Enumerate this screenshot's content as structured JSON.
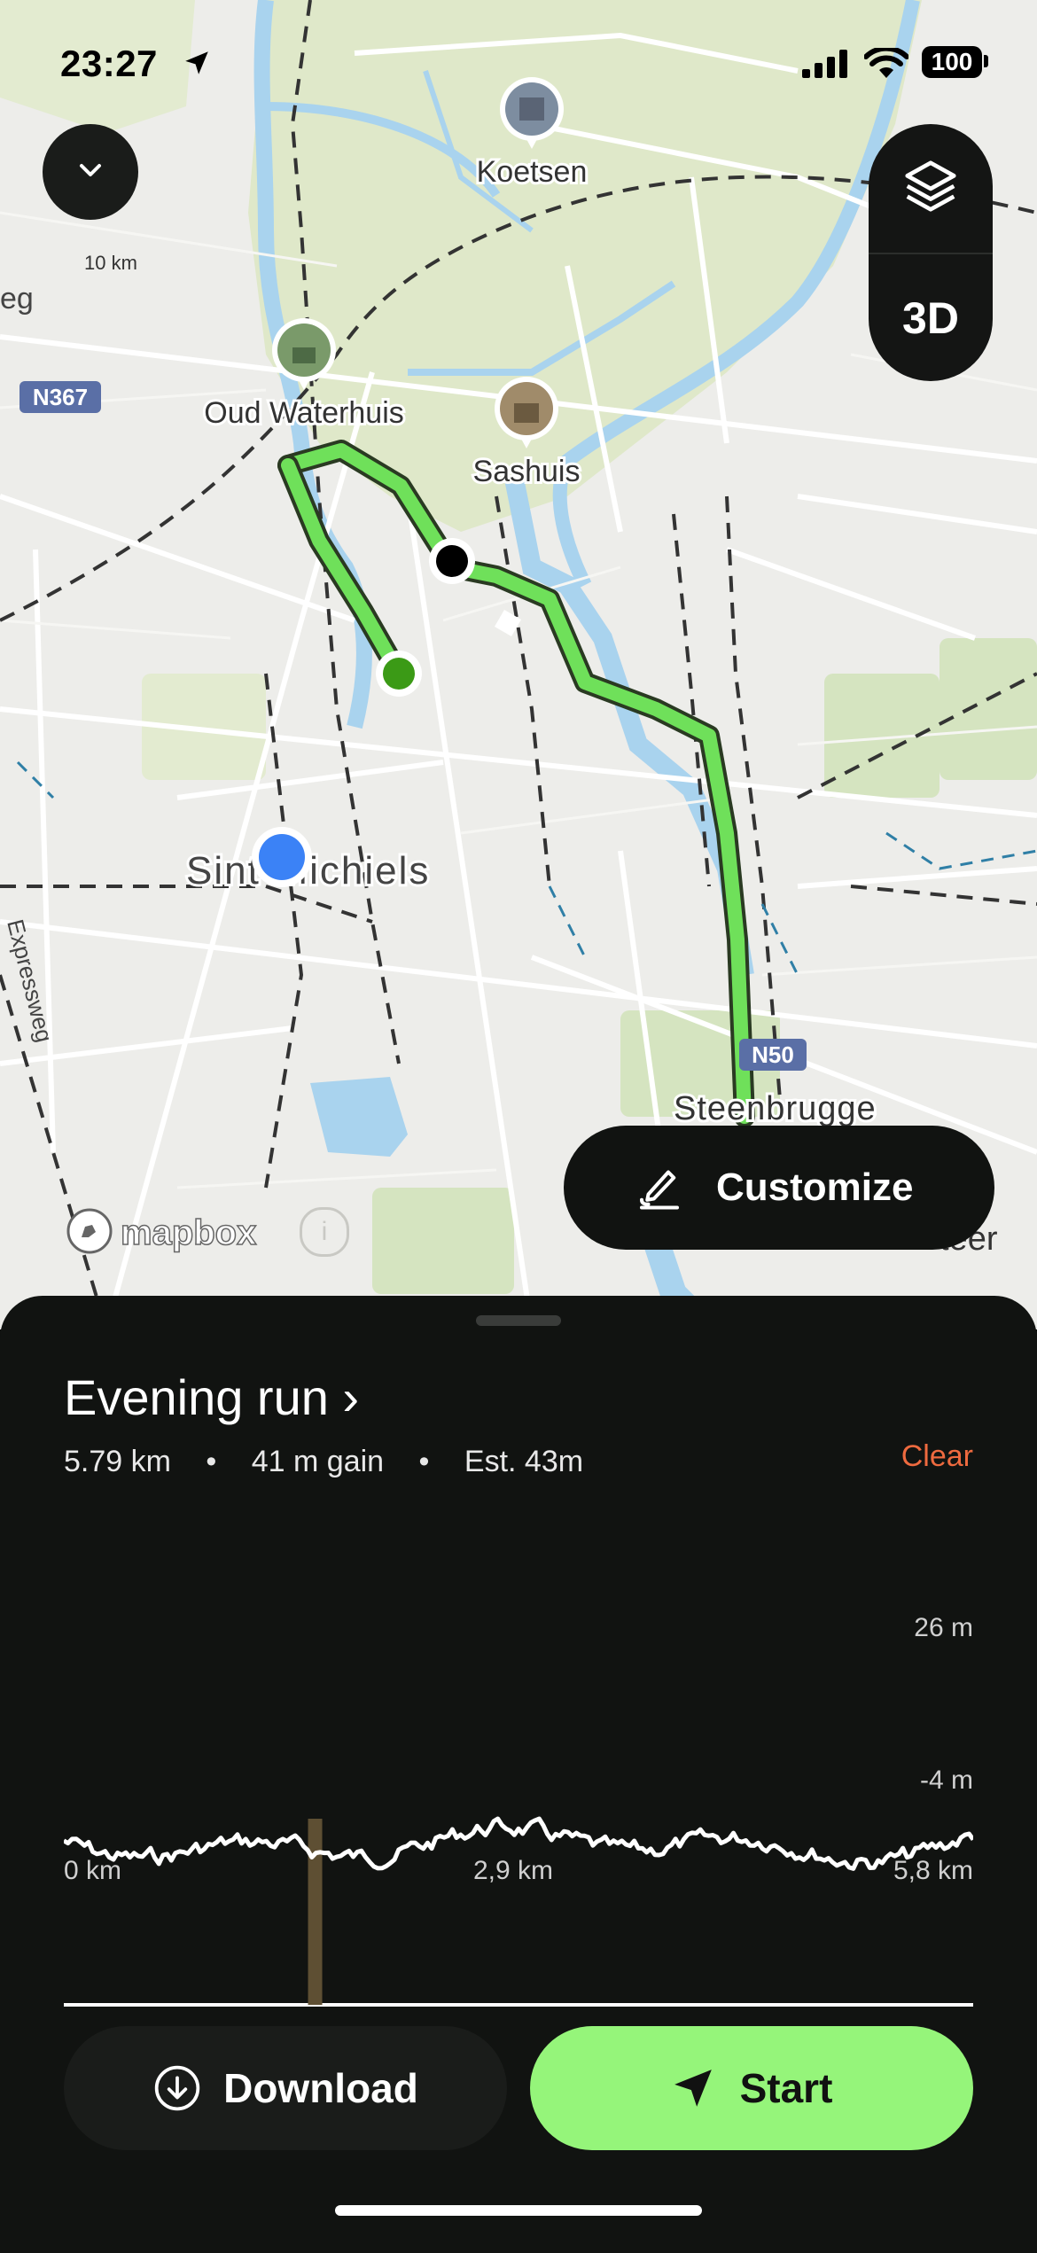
{
  "status_bar": {
    "time": "23:27",
    "battery": "100"
  },
  "map": {
    "scale_label": "10 km",
    "road_badges": [
      "N367",
      "N50"
    ],
    "pois": [
      {
        "name": "Koetsen"
      },
      {
        "name": "Oud Waterhuis"
      },
      {
        "name": "Sashuis"
      }
    ],
    "place_labels": [
      "Sint-Michiels",
      "Steenbrugge",
      "Expressweg",
      "eg",
      "teer"
    ],
    "layers_icon": "layers-icon",
    "button_3d": "3D",
    "attribution": "mapbox",
    "route_color": "#6fe05a",
    "start_marker_color": "#3b9a16",
    "end_marker_color": "#000000",
    "user_location_color": "#3b82f6"
  },
  "customize_label": "Customize",
  "route": {
    "title": "Evening run ›",
    "distance": "5.79 km",
    "gain": "41 m gain",
    "estimate": "Est. 43m",
    "clear_label": "Clear",
    "separator": "•"
  },
  "elevation": {
    "max_label": "26 m",
    "min_label": "-4 m",
    "x_labels": [
      "0 km",
      "2,9 km",
      "5,8 km"
    ],
    "marker_km": 1.6
  },
  "actions": {
    "download_label": "Download",
    "start_label": "Start"
  },
  "colors": {
    "accent": "#95f57a",
    "clear": "#ee6a3f",
    "sheet_bg": "#111311"
  }
}
